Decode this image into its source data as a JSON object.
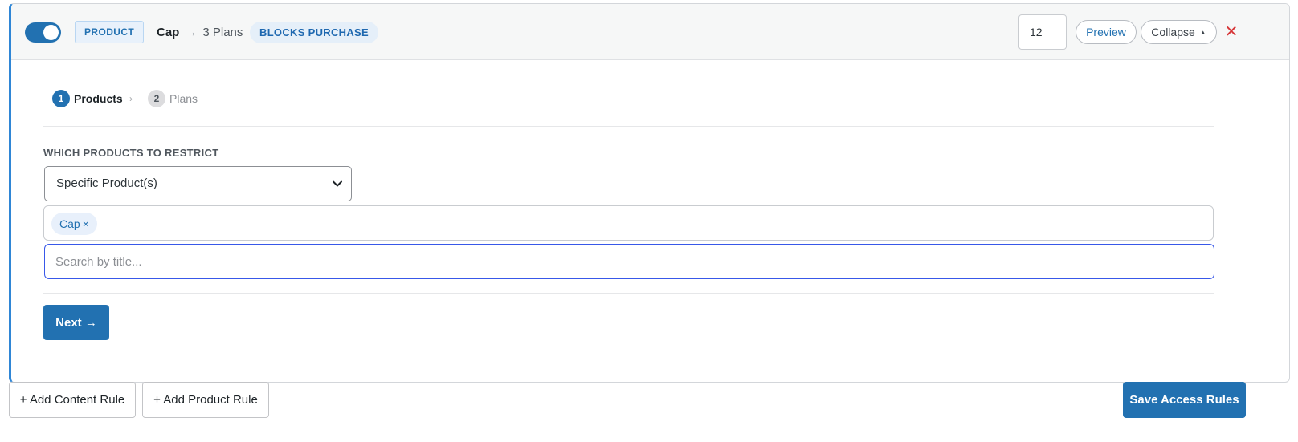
{
  "rule": {
    "enabled": true,
    "type_badge": "PRODUCT",
    "product_name": "Cap",
    "arrow": "→",
    "plans_summary": "3 Plans",
    "effect_badge": "BLOCKS PURCHASE",
    "priority_value": "12",
    "preview_label": "Preview",
    "collapse_label": "Collapse",
    "collapse_caret": "▲",
    "close_glyph": "✕"
  },
  "steps": [
    {
      "number": "1",
      "label": "Products",
      "active": true
    },
    {
      "number": "2",
      "label": "Plans",
      "active": false
    }
  ],
  "step_separator": "›",
  "products_section": {
    "label": "WHICH PRODUCTS TO RESTRICT",
    "select_value": "Specific Product(s)",
    "selected_tags": [
      {
        "label": "Cap",
        "remove_glyph": "×"
      }
    ],
    "search_placeholder": "Search by title..."
  },
  "next_button": "Next →",
  "footer": {
    "add_content_rule": "+ Add Content Rule",
    "add_product_rule": "+ Add Product Rule",
    "save": "Save Access Rules"
  },
  "colors": {
    "primary": "#2271b1",
    "accent_border": "#2f86d6",
    "close_red": "#d63638",
    "search_focus": "#3858e9"
  }
}
